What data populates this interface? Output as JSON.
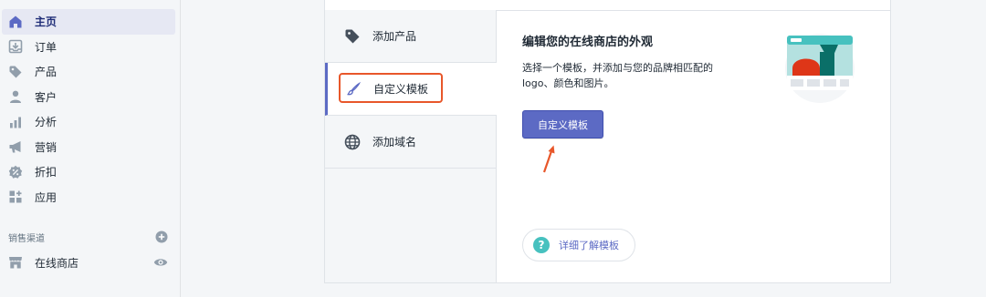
{
  "sidebar": {
    "items": [
      {
        "label": "主页",
        "icon": "home-icon"
      },
      {
        "label": "订单",
        "icon": "orders-icon"
      },
      {
        "label": "产品",
        "icon": "tag-icon"
      },
      {
        "label": "客户",
        "icon": "user-icon"
      },
      {
        "label": "分析",
        "icon": "bar-chart-icon"
      },
      {
        "label": "营销",
        "icon": "megaphone-icon"
      },
      {
        "label": "折扣",
        "icon": "discount-icon"
      },
      {
        "label": "应用",
        "icon": "apps-icon"
      }
    ],
    "active_item": "主页",
    "sales_channels": {
      "heading": "销售渠道",
      "add_icon": "plus-circle-icon",
      "channels": [
        {
          "label": "在线商店",
          "icon": "store-icon",
          "action_icon": "eye-icon"
        }
      ]
    }
  },
  "setup_card": {
    "tabs": [
      {
        "label": "添加产品",
        "icon": "tag-icon"
      },
      {
        "label": "自定义模板",
        "icon": "brush-icon"
      },
      {
        "label": "添加域名",
        "icon": "globe-icon"
      }
    ],
    "selected_tab": "自定义模板",
    "content": {
      "title": "编辑您的在线商店的外观",
      "description": "选择一个模板，并添加与您的品牌相匹配的logo、颜色和图片。",
      "primary_button": "自定义模板",
      "help_link": "详细了解模板"
    }
  },
  "colors": {
    "accent": "#5c6ac4",
    "highlight_annotation": "#e8572a",
    "help_icon": "#47c1bf"
  }
}
